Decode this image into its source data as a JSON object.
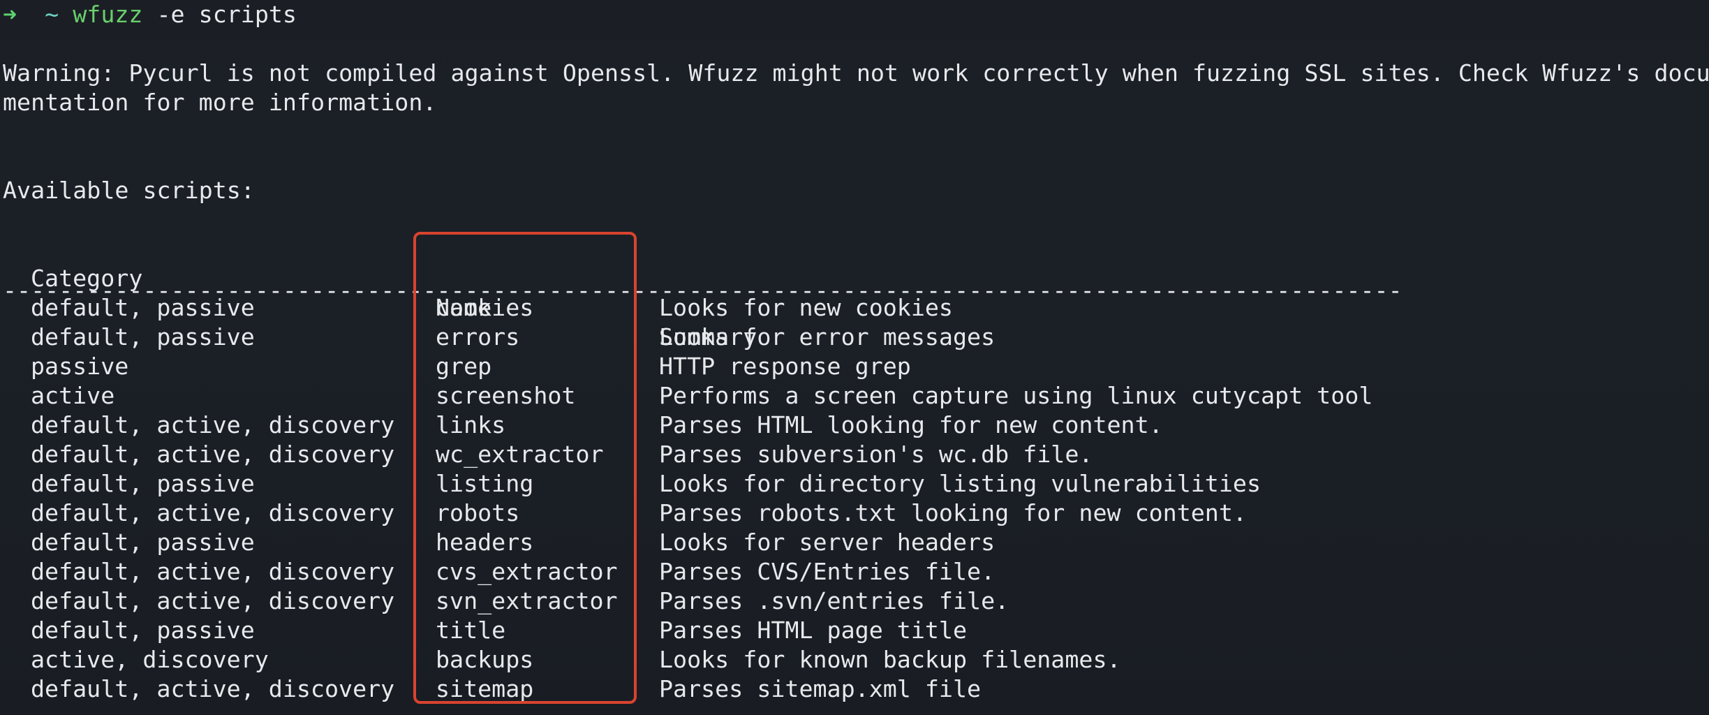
{
  "prompt": {
    "arrow": "➜",
    "dir": "~",
    "command": "wfuzz",
    "args": "-e scripts"
  },
  "warning": {
    "line1": "Warning: Pycurl is not compiled against Openssl. Wfuzz might not work correctly when fuzzing SSL sites. Check Wfuzz's docu",
    "line2": "mentation for more information."
  },
  "heading": "Available scripts:",
  "table": {
    "headers": {
      "category": "Category",
      "name": "Name",
      "summary": "Summary"
    },
    "divider": "--------------------------------------------------------------------------------------------------------------------------------------------------------------------------------------------------------------------------",
    "rows": [
      {
        "category": "default, passive",
        "name": "cookies",
        "summary": "Looks for new cookies"
      },
      {
        "category": "default, passive",
        "name": "errors",
        "summary": "Looks for error messages"
      },
      {
        "category": "passive",
        "name": "grep",
        "summary": "HTTP response grep"
      },
      {
        "category": "active",
        "name": "screenshot",
        "summary": "Performs a screen capture using linux cutycapt tool"
      },
      {
        "category": "default, active, discovery",
        "name": "links",
        "summary": "Parses HTML looking for new content."
      },
      {
        "category": "default, active, discovery",
        "name": "wc_extractor",
        "summary": "Parses subversion's wc.db file."
      },
      {
        "category": "default, passive",
        "name": "listing",
        "summary": "Looks for directory listing vulnerabilities"
      },
      {
        "category": "default, active, discovery",
        "name": "robots",
        "summary": "Parses robots.txt looking for new content."
      },
      {
        "category": "default, passive",
        "name": "headers",
        "summary": "Looks for server headers"
      },
      {
        "category": "default, active, discovery",
        "name": "cvs_extractor",
        "summary": "Parses CVS/Entries file."
      },
      {
        "category": "default, active, discovery",
        "name": "svn_extractor",
        "summary": "Parses .svn/entries file."
      },
      {
        "category": "default, passive",
        "name": "title",
        "summary": "Parses HTML page title"
      },
      {
        "category": "active, discovery",
        "name": "backups",
        "summary": "Looks for known backup filenames."
      },
      {
        "category": "default, active, discovery",
        "name": "sitemap",
        "summary": "Parses sitemap.xml file"
      }
    ]
  },
  "colors": {
    "background": "#1b1f25",
    "text": "#e7e9ec",
    "prompt_green": "#69cf6b",
    "highlight_red": "#d9432f"
  }
}
